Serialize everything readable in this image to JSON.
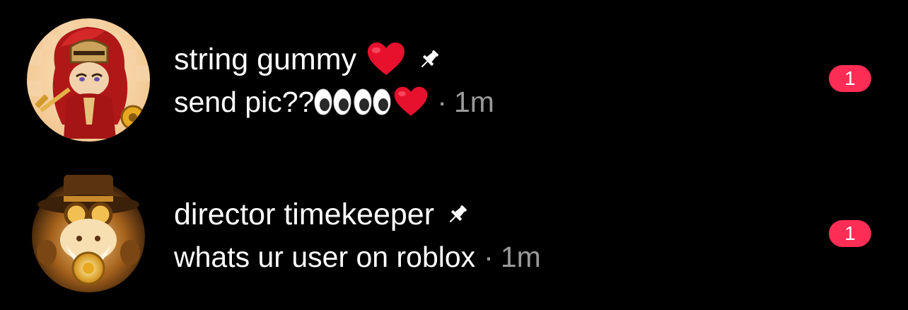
{
  "conversations": [
    {
      "name": "string gummy",
      "name_emoji": "red-heart",
      "pinned": true,
      "preview": "send pic??",
      "preview_emojis": [
        "eyes",
        "eyes",
        "red-heart"
      ],
      "separator": "·",
      "time": "1m",
      "unread_count": "1"
    },
    {
      "name": "director timekeeper",
      "pinned": true,
      "preview": "whats ur user on roblox",
      "separator": "·",
      "time": "1m",
      "unread_count": "1"
    }
  ],
  "colors": {
    "background": "#000000",
    "text": "#ffffff",
    "secondary_text": "#9a9a9a",
    "badge": "#fe2d55"
  }
}
